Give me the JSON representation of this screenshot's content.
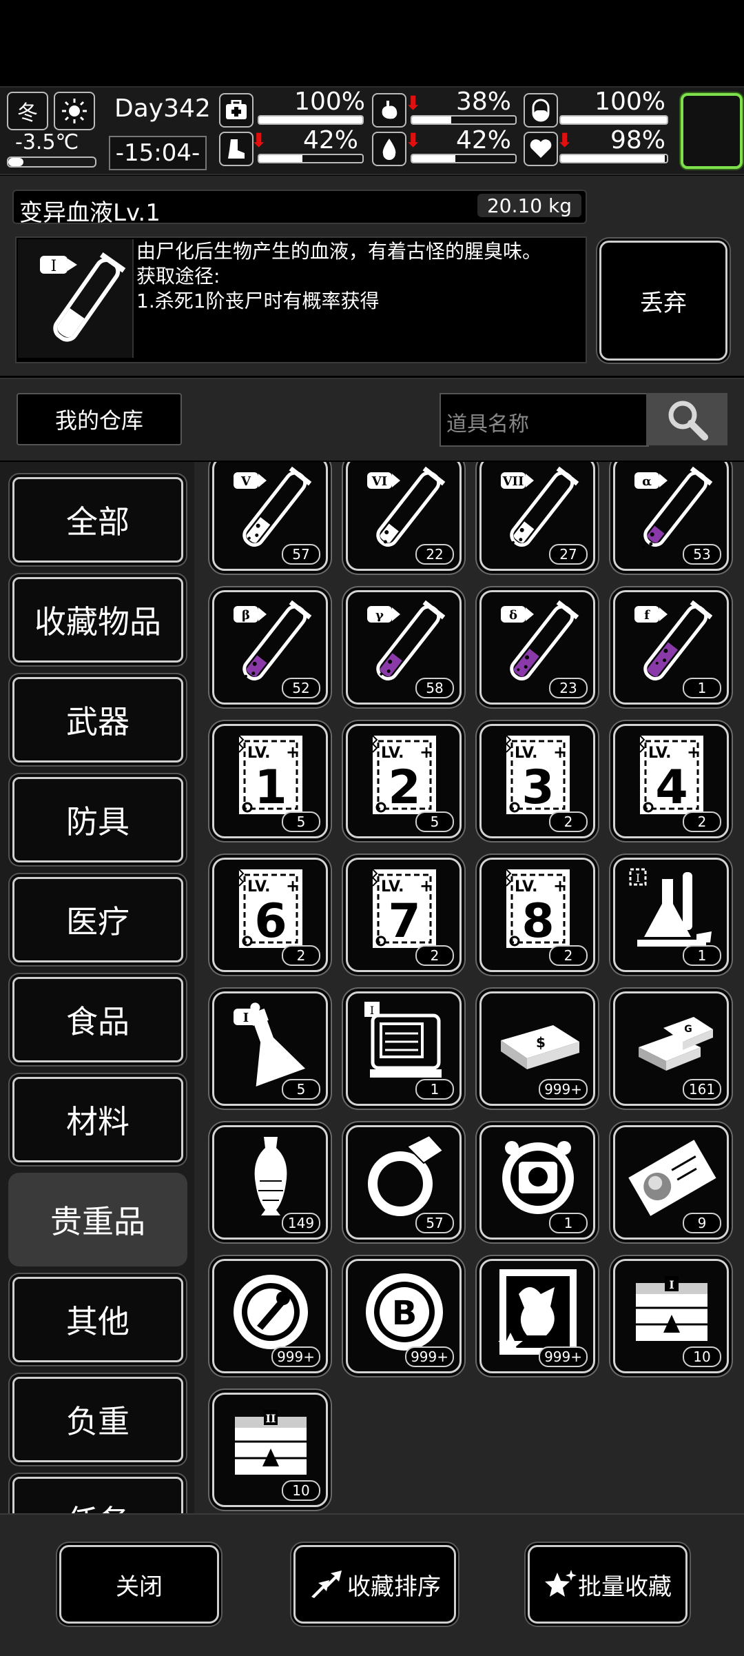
{
  "status": {
    "season": "冬",
    "temperature": "-3.5℃",
    "day": "Day342",
    "time": "-15:04-",
    "stats": [
      {
        "name": "health",
        "pct": "100%",
        "value": 1.0,
        "down": false
      },
      {
        "name": "hunger",
        "pct": "38%",
        "value": 0.38,
        "down": true
      },
      {
        "name": "spirit",
        "pct": "100%",
        "value": 1.0,
        "down": false
      },
      {
        "name": "stamina",
        "pct": "42%",
        "value": 0.42,
        "down": true
      },
      {
        "name": "thirst",
        "pct": "42%",
        "value": 0.42,
        "down": true
      },
      {
        "name": "mood",
        "pct": "98%",
        "value": 0.98,
        "down": true
      }
    ]
  },
  "detail": {
    "title": "变异血液Lv.1",
    "weight": "20.10 kg",
    "tier": "I",
    "description": "由尸化后生物产生的血液，有着古怪的腥臭味。\n获取途径:\n1.杀死1阶丧尸时有概率获得",
    "discard_label": "丢弃"
  },
  "storage": {
    "title": "我的仓库",
    "search_placeholder": "道具名称"
  },
  "categories": [
    "全部",
    "收藏物品",
    "武器",
    "防具",
    "医疗",
    "食品",
    "材料",
    "贵重品",
    "其他",
    "负重",
    "任务"
  ],
  "active_category": 7,
  "items": [
    {
      "kind": "tube",
      "label": "V",
      "count": "57",
      "liquid": "white",
      "level": 0.55
    },
    {
      "kind": "tube",
      "label": "VI",
      "count": "22",
      "liquid": "white",
      "level": 0.4
    },
    {
      "kind": "tube",
      "label": "VII",
      "count": "27",
      "liquid": "white",
      "level": 0.45
    },
    {
      "kind": "tube",
      "label": "α",
      "count": "53",
      "liquid": "purple",
      "level": 0.35
    },
    {
      "kind": "tube",
      "label": "β",
      "count": "52",
      "liquid": "purple",
      "level": 0.45
    },
    {
      "kind": "tube",
      "label": "γ",
      "count": "58",
      "liquid": "purple",
      "level": 0.5
    },
    {
      "kind": "tube",
      "label": "δ",
      "count": "23",
      "liquid": "purple",
      "level": 0.6
    },
    {
      "kind": "tube",
      "label": "f",
      "count": "1",
      "liquid": "purple",
      "level": 0.75
    },
    {
      "kind": "ticket",
      "label": "1",
      "count": "5"
    },
    {
      "kind": "ticket",
      "label": "2",
      "count": "5"
    },
    {
      "kind": "ticket",
      "label": "3",
      "count": "2"
    },
    {
      "kind": "ticket",
      "label": "4",
      "count": "2"
    },
    {
      "kind": "ticket",
      "label": "6",
      "count": "2"
    },
    {
      "kind": "ticket",
      "label": "7",
      "count": "2"
    },
    {
      "kind": "ticket",
      "label": "8",
      "count": "2"
    },
    {
      "kind": "lab",
      "label": "I",
      "count": "1"
    },
    {
      "kind": "flask",
      "label": "I",
      "count": "5"
    },
    {
      "kind": "machine",
      "label": "I",
      "count": "1"
    },
    {
      "kind": "cash",
      "label": "$",
      "count": "999+"
    },
    {
      "kind": "gold",
      "label": "G",
      "count": "161"
    },
    {
      "kind": "vase",
      "label": "",
      "count": "149"
    },
    {
      "kind": "ring",
      "label": "",
      "count": "57"
    },
    {
      "kind": "badge",
      "label": "",
      "count": "1"
    },
    {
      "kind": "photo",
      "label": "",
      "count": "9"
    },
    {
      "kind": "token",
      "label": "",
      "count": "999+"
    },
    {
      "kind": "coin",
      "label": "B",
      "count": "999+"
    },
    {
      "kind": "card",
      "label": "",
      "count": "999+"
    },
    {
      "kind": "crate",
      "label": "I",
      "count": "10"
    },
    {
      "kind": "crate",
      "label": "II",
      "count": "10"
    }
  ],
  "bottom": {
    "close_label": "关闭",
    "sort_label": "收藏排序",
    "batch_label": "批量收藏"
  }
}
